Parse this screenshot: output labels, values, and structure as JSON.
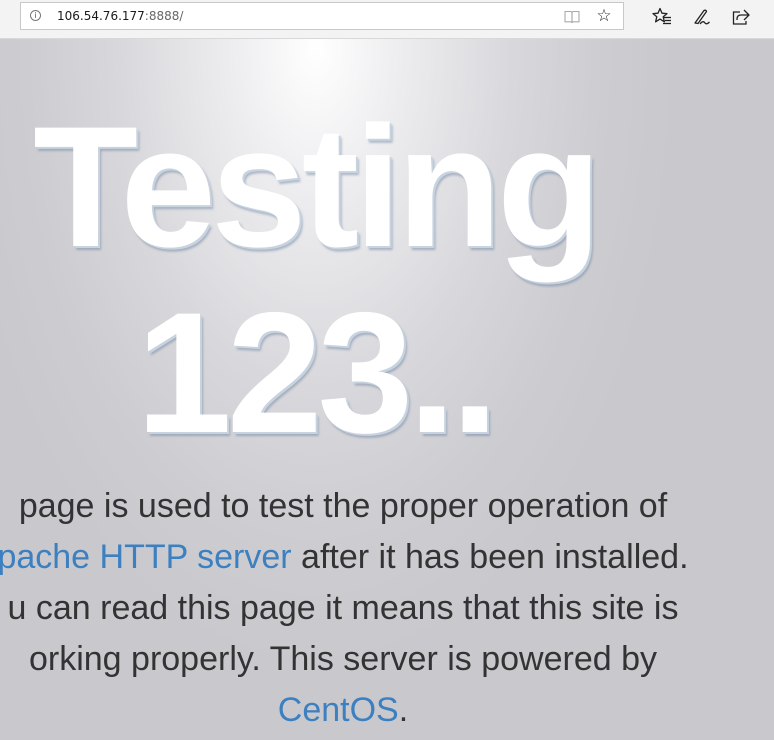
{
  "browser": {
    "url_host": "106.54.76.177",
    "url_port": ":8888/"
  },
  "page": {
    "heading_line1": "Testing",
    "heading_line2": "123..",
    "text_1": "page is used to test the proper operation of",
    "link_apache": "pache HTTP server",
    "text_2": " after it has been installed.",
    "text_3": "u can read this page it means that this site is",
    "text_4": "orking properly. This server is powered by",
    "link_centos": "CentOS",
    "text_5": "."
  }
}
